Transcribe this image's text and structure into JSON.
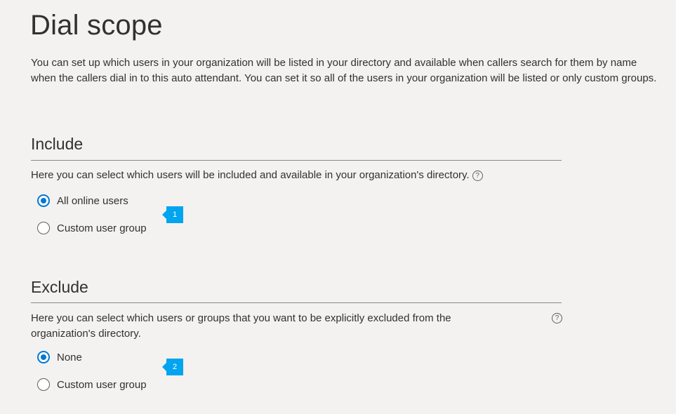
{
  "page_title": "Dial scope",
  "intro": "You can set up which users in your organization will be listed in your directory and available when callers search for them by name when the callers dial in to this auto attendant. You can set it so all of the users in your organization will be listed or only custom groups.",
  "include": {
    "heading": "Include",
    "description": "Here you can select which users will be included and available in your organization's directory.",
    "help_glyph": "?",
    "options": [
      {
        "label": "All online users",
        "checked": true
      },
      {
        "label": "Custom user group",
        "checked": false
      }
    ],
    "callout": "1"
  },
  "exclude": {
    "heading": "Exclude",
    "description": "Here you can select which users or groups that you want to be explicitly excluded from the organization's directory.",
    "help_glyph": "?",
    "options": [
      {
        "label": "None",
        "checked": true
      },
      {
        "label": "Custom user group",
        "checked": false
      }
    ],
    "callout": "2"
  },
  "colors": {
    "accent": "#0078d4",
    "callout": "#00a4ef",
    "background": "#f3f2f1"
  }
}
